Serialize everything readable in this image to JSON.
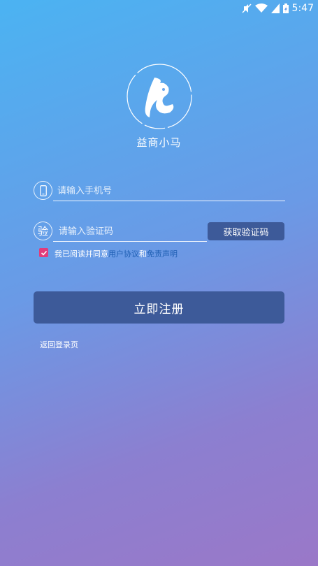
{
  "status_bar": {
    "time": "5:47",
    "icons": [
      "mute-icon",
      "wifi-icon",
      "signal-icon",
      "battery-icon"
    ]
  },
  "app": {
    "name": "益商小马",
    "logo_icon": "horse-head-flame-icon"
  },
  "phone": {
    "icon_label": "phone-icon",
    "placeholder": "请输入手机号",
    "value": ""
  },
  "code": {
    "icon_char": "验",
    "placeholder": "请输入验证码",
    "value": "",
    "button_label": "获取验证码"
  },
  "agreement": {
    "checked": true,
    "prefix": "我已阅读并同意",
    "user_agreement": "用户协议",
    "and": "和",
    "disclaimer": "免责声明"
  },
  "submit": {
    "label": "立即注册"
  },
  "back": {
    "label": "返回登录页"
  },
  "colors": {
    "button": "#3d5a99",
    "checkbox": "#e23c7b",
    "link": "#1f5fb3"
  }
}
